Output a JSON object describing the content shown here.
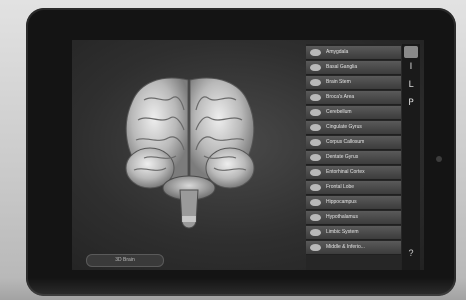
{
  "list": {
    "items": [
      {
        "label": "Amygdala"
      },
      {
        "label": "Basal Ganglia"
      },
      {
        "label": "Brain Stem"
      },
      {
        "label": "Broca's Area"
      },
      {
        "label": "Cerebellum"
      },
      {
        "label": "Cingulate Gyrus"
      },
      {
        "label": "Corpus Callosum"
      },
      {
        "label": "Dentate Gyrus"
      },
      {
        "label": "Entorhinal Cortex"
      },
      {
        "label": "Frontal Lobe"
      },
      {
        "label": "Hippocampus"
      },
      {
        "label": "Hypothalamus"
      },
      {
        "label": "Limbic System"
      },
      {
        "label": "Middle & Inferio..."
      }
    ]
  },
  "index_bar": {
    "letters": [
      "I",
      "L",
      "P"
    ],
    "help": "?"
  },
  "bottom_button": {
    "label": "3D Brain"
  },
  "icons": {
    "brain_model": "brain-3d-icon",
    "list_thumb": "brain-thumbnail-icon",
    "help": "question-icon",
    "camera": "camera-icon"
  },
  "colors": {
    "screen_bg": "#2f2f2f",
    "list_item": "#4a4a4a",
    "bezel": "#141414"
  }
}
